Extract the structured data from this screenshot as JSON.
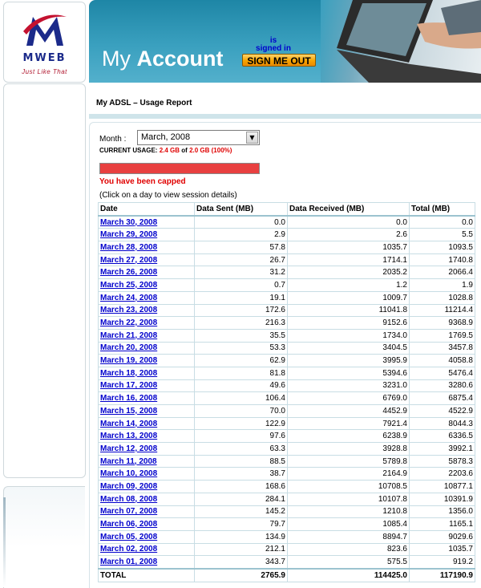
{
  "brand": {
    "logo_text": "MWEB",
    "tagline": "Just Like That"
  },
  "header": {
    "title_light": "My ",
    "title_bold": "Account",
    "signed_in_line1": "is",
    "signed_in_line2": "signed in",
    "signout_label": "SIGN ME OUT"
  },
  "page": {
    "title": "My ADSL – Usage Report"
  },
  "report": {
    "month_label": "Month :",
    "month_value": "March, 2008",
    "usage_prefix": "CURRENT USAGE:",
    "usage_used": "2.4 GB",
    "usage_of": "of",
    "usage_cap": "2.0 GB",
    "usage_percent": "(100%)",
    "usage_fraction": 1.0,
    "capped_message": "You have been capped",
    "click_note": "(Click on a day to view session details)"
  },
  "table": {
    "headers": [
      "Date",
      "Data Sent (MB)",
      "Data Received (MB)",
      "Total (MB)"
    ],
    "rows": [
      [
        "March 30, 2008",
        "0.0",
        "0.0",
        "0.0"
      ],
      [
        "March 29, 2008",
        "2.9",
        "2.6",
        "5.5"
      ],
      [
        "March 28, 2008",
        "57.8",
        "1035.7",
        "1093.5"
      ],
      [
        "March 27, 2008",
        "26.7",
        "1714.1",
        "1740.8"
      ],
      [
        "March 26, 2008",
        "31.2",
        "2035.2",
        "2066.4"
      ],
      [
        "March 25, 2008",
        "0.7",
        "1.2",
        "1.9"
      ],
      [
        "March 24, 2008",
        "19.1",
        "1009.7",
        "1028.8"
      ],
      [
        "March 23, 2008",
        "172.6",
        "11041.8",
        "11214.4"
      ],
      [
        "March 22, 2008",
        "216.3",
        "9152.6",
        "9368.9"
      ],
      [
        "March 21, 2008",
        "35.5",
        "1734.0",
        "1769.5"
      ],
      [
        "March 20, 2008",
        "53.3",
        "3404.5",
        "3457.8"
      ],
      [
        "March 19, 2008",
        "62.9",
        "3995.9",
        "4058.8"
      ],
      [
        "March 18, 2008",
        "81.8",
        "5394.6",
        "5476.4"
      ],
      [
        "March 17, 2008",
        "49.6",
        "3231.0",
        "3280.6"
      ],
      [
        "March 16, 2008",
        "106.4",
        "6769.0",
        "6875.4"
      ],
      [
        "March 15, 2008",
        "70.0",
        "4452.9",
        "4522.9"
      ],
      [
        "March 14, 2008",
        "122.9",
        "7921.4",
        "8044.3"
      ],
      [
        "March 13, 2008",
        "97.6",
        "6238.9",
        "6336.5"
      ],
      [
        "March 12, 2008",
        "63.3",
        "3928.8",
        "3992.1"
      ],
      [
        "March 11, 2008",
        "88.5",
        "5789.8",
        "5878.3"
      ],
      [
        "March 10, 2008",
        "38.7",
        "2164.9",
        "2203.6"
      ],
      [
        "March 09, 2008",
        "168.6",
        "10708.5",
        "10877.1"
      ],
      [
        "March 08, 2008",
        "284.1",
        "10107.8",
        "10391.9"
      ],
      [
        "March 07, 2008",
        "145.2",
        "1210.8",
        "1356.0"
      ],
      [
        "March 06, 2008",
        "79.7",
        "1085.4",
        "1165.1"
      ],
      [
        "March 05, 2008",
        "134.9",
        "8894.7",
        "9029.6"
      ],
      [
        "March 02, 2008",
        "212.1",
        "823.6",
        "1035.7"
      ],
      [
        "March 01, 2008",
        "343.7",
        "575.5",
        "919.2"
      ]
    ],
    "total": [
      "TOTAL",
      "2765.9",
      "114425.0",
      "117190.9"
    ]
  },
  "colors": {
    "header_blue": "#2a93b3",
    "link_blue": "#0000cc",
    "alert_red": "#e00000",
    "button_orange": "#f7a400"
  }
}
